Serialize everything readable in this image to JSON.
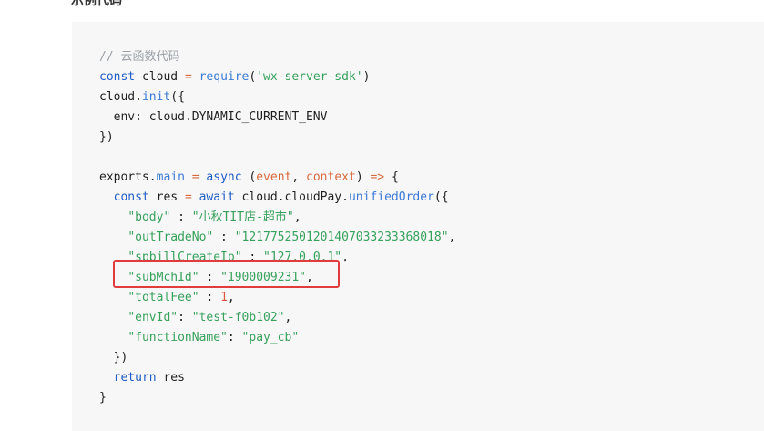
{
  "heading": "示例代码",
  "code": {
    "comment": "// 云函数代码",
    "l2": {
      "const": "const",
      "cloud": " cloud ",
      "eq": "=",
      "require": " require",
      "open": "(",
      "arg": "'wx-server-sdk'",
      "close": ")"
    },
    "l3": {
      "obj": "cloud.",
      "method": "init",
      "rest": "({"
    },
    "l4": "  env: cloud.DYNAMIC_CURRENT_ENV",
    "l5": "})",
    "l7": {
      "exports": "exports.",
      "main": "main",
      "eq": " = ",
      "async": "async",
      "sp": " (",
      "p1": "event",
      "comma": ", ",
      "p2": "context",
      "close": ") ",
      "arrow": "=>",
      "brace": " {"
    },
    "l8": {
      "indent": "  ",
      "const": "const",
      "res": " res ",
      "eq": "=",
      "await": " await",
      "path": " cloud.cloudPay.",
      "method": "unifiedOrder",
      "open": "({"
    },
    "l9": {
      "key": "\"body\"",
      "sep": " : ",
      "val": "\"小秋TIT店-超市\"",
      "end": ","
    },
    "l10": {
      "key": "\"outTradeNo\"",
      "sep": " : ",
      "val": "\"1217752501201407033233368018\"",
      "end": ","
    },
    "l11": {
      "key": "\"spbillCreateIp\"",
      "sep": " : ",
      "val": "\"127.0.0.1\"",
      "end": ","
    },
    "l12": {
      "key": "\"subMchId\"",
      "sep": " : ",
      "val": "\"1900009231\"",
      "end": ","
    },
    "l13": {
      "key": "\"totalFee\"",
      "sep": " : ",
      "val": "1",
      "end": ","
    },
    "l14": {
      "key": "\"envId\"",
      "sep": ": ",
      "val": "\"test-f0b102\"",
      "end": ","
    },
    "l15": {
      "key": "\"functionName\"",
      "sep": ": ",
      "val": "\"pay_cb\""
    },
    "l16": "  })",
    "l17": {
      "return": "return",
      "res": " res"
    },
    "l18": "}"
  },
  "colors": {
    "highlight": "#e23b3b",
    "keyword": "#1e5cc6",
    "string": "#36a15b",
    "number": "#e0563d"
  }
}
